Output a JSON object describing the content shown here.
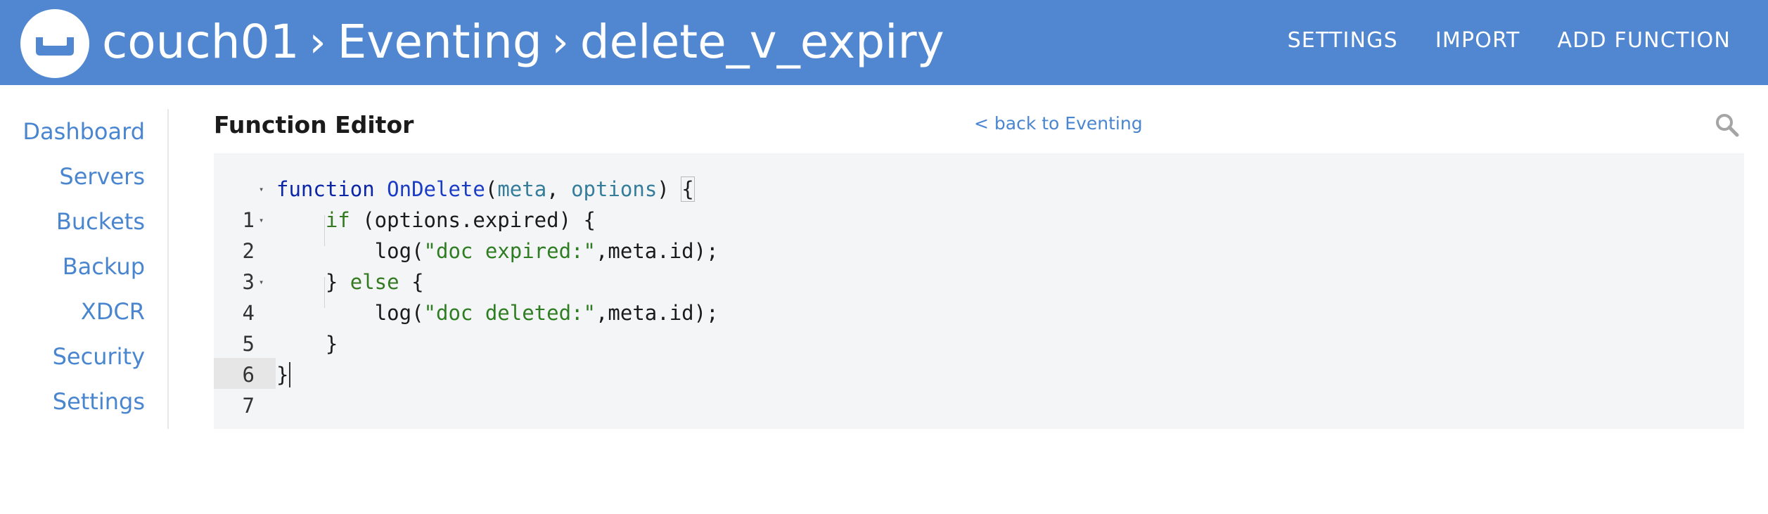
{
  "header": {
    "crumbs": [
      "couch01",
      "Eventing",
      "delete_v_expiry"
    ],
    "separator": "›",
    "nav": [
      "SETTINGS",
      "IMPORT",
      "ADD FUNCTION"
    ],
    "logo_icon": "couchbase-logo-icon",
    "bg_color": "#5187d0"
  },
  "sidebar": {
    "items": [
      "Dashboard",
      "Servers",
      "Buckets",
      "Backup",
      "XDCR",
      "Security",
      "Settings"
    ]
  },
  "editor": {
    "title": "Function Editor",
    "back_link": "< back to Eventing",
    "search_icon": "search-icon",
    "lines": [
      {
        "n": "1",
        "fold": "▾"
      },
      {
        "n": "2",
        "fold": "▾"
      },
      {
        "n": "3",
        "fold": ""
      },
      {
        "n": "4",
        "fold": "▾"
      },
      {
        "n": "5",
        "fold": ""
      },
      {
        "n": "6",
        "fold": ""
      },
      {
        "n": "7",
        "fold": ""
      }
    ],
    "tokens": {
      "l1_kw": "function",
      "l1_fn": "OnDelete",
      "l1_open": "(",
      "l1_p1": "meta",
      "l1_comma": ", ",
      "l1_p2": "options",
      "l1_close": ") ",
      "l1_brace": "{",
      "l2_indent": "    ",
      "l2_kw": "if",
      "l2_rest": " (options.expired) {",
      "l3_indent": "        ",
      "l3_a": "log(",
      "l3_str": "\"doc expired:\"",
      "l3_b": ",meta.id);",
      "l4_indent": "    ",
      "l4_a": "} ",
      "l4_kw": "else",
      "l4_b": " {",
      "l5_indent": "        ",
      "l5_a": "log(",
      "l5_str": "\"doc deleted:\"",
      "l5_b": ",meta.id);",
      "l6": "    }",
      "l7": "}"
    }
  }
}
